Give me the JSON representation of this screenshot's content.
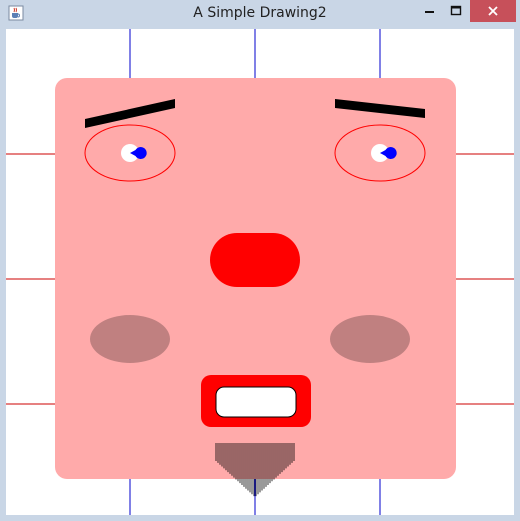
{
  "window": {
    "title": "A Simple Drawing2",
    "app_icon": "java-coffee-cup-icon",
    "controls": {
      "minimize_icon": "minimize-icon",
      "maximize_icon": "maximize-icon",
      "close_icon": "close-icon"
    }
  },
  "drawing": {
    "background_color": "#ffffff",
    "grid_vertical_color": "#0000cc",
    "grid_horizontal_color": "#cc0000",
    "face_color": "#ffaaaa",
    "eyebrow_color": "#000000",
    "eye_outline_color": "#ff0000",
    "pupil_color": "#0000ff",
    "nose_color": "#ff0000",
    "cheek_color": "#c08080",
    "mouth_color": "#ff0000",
    "teeth_color": "#ffffff",
    "beard_color": "#000000"
  }
}
